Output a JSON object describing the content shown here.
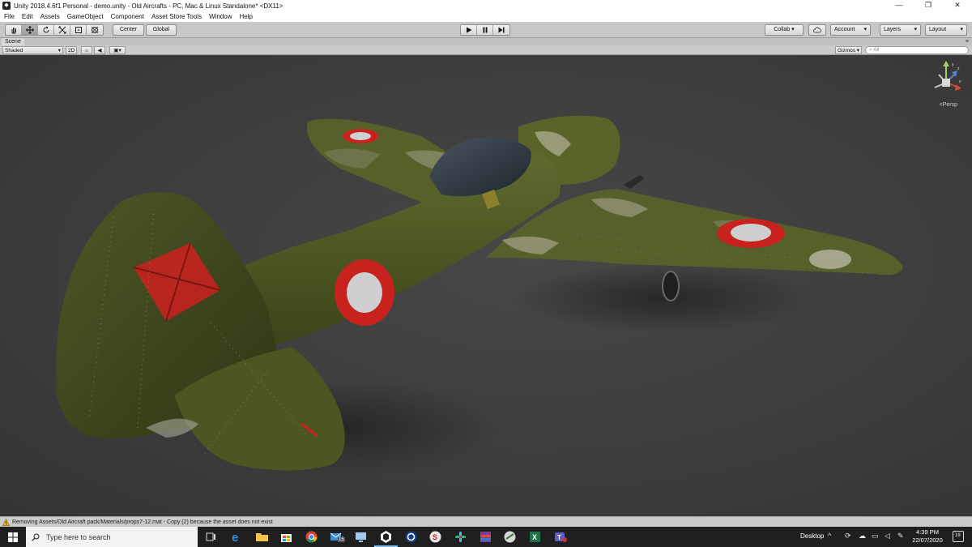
{
  "window": {
    "title": "Unity 2018.4.6f1 Personal - demo.unity - Old Aircrafts - PC, Mac & Linux Standalone* <DX11>",
    "minimize_glyph": "—",
    "maximize_glyph": "❐",
    "close_glyph": "✕"
  },
  "menu": {
    "items": [
      "File",
      "Edit",
      "Assets",
      "GameObject",
      "Component",
      "Asset Store Tools",
      "Window",
      "Help"
    ]
  },
  "toolbar": {
    "tools": [
      "hand-tool",
      "move-tool",
      "rotate-tool",
      "scale-tool",
      "rect-tool",
      "transform-tool"
    ],
    "pivot_label": "Center",
    "space_label": "Global",
    "collab_label": "Collab ▾",
    "account_label": "Account",
    "layers_label": "Layers",
    "layout_label": "Layout"
  },
  "scene": {
    "tab_label": "Scene",
    "shading_mode": "Shaded",
    "mode_2d": "2D",
    "gizmos_label": "Gizmos",
    "search_placeholder": "All",
    "projection_label": "Persp"
  },
  "console": {
    "message": "Removing Assets/Old Aircraft pack/Materials/props7-12.mat - Copy (2) because the asset does not exist"
  },
  "taskbar": {
    "search_placeholder": "Type here to search",
    "desktop_label": "Desktop",
    "time": "4:39 PM",
    "date": "22/07/2020",
    "mail_badge": "15",
    "notification_count": "19"
  },
  "colors": {
    "accent": "#76b9ed",
    "roundel_red": "#c8221f",
    "camo_green": "#4f5a26"
  }
}
